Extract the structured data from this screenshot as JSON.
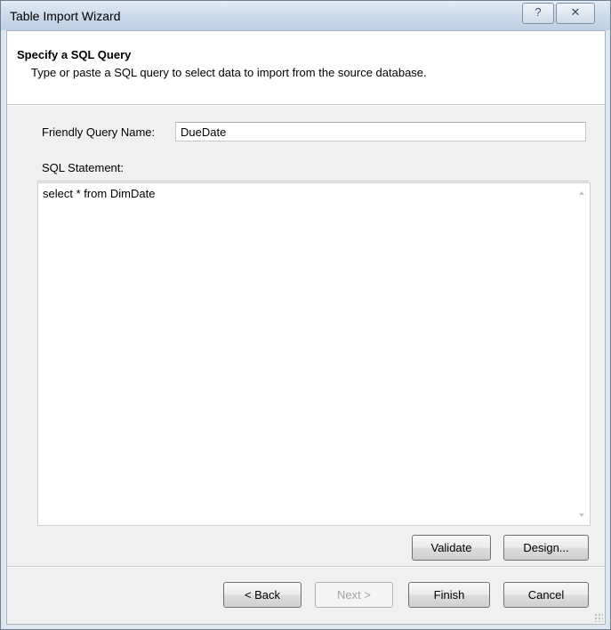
{
  "window": {
    "title": "Table Import Wizard",
    "help_glyph": "?",
    "close_glyph": "✕"
  },
  "header": {
    "title": "Specify a SQL Query",
    "subtitle": "Type or paste a SQL query to select data to import from the source database."
  },
  "form": {
    "friendly_name_label": "Friendly Query Name:",
    "friendly_name_value": "DueDate",
    "sql_label": "SQL Statement:",
    "sql_value": "select * from DimDate"
  },
  "actions": {
    "validate": "Validate",
    "design": "Design..."
  },
  "footer": {
    "back": "< Back",
    "next": "Next >",
    "finish": "Finish",
    "cancel": "Cancel"
  }
}
